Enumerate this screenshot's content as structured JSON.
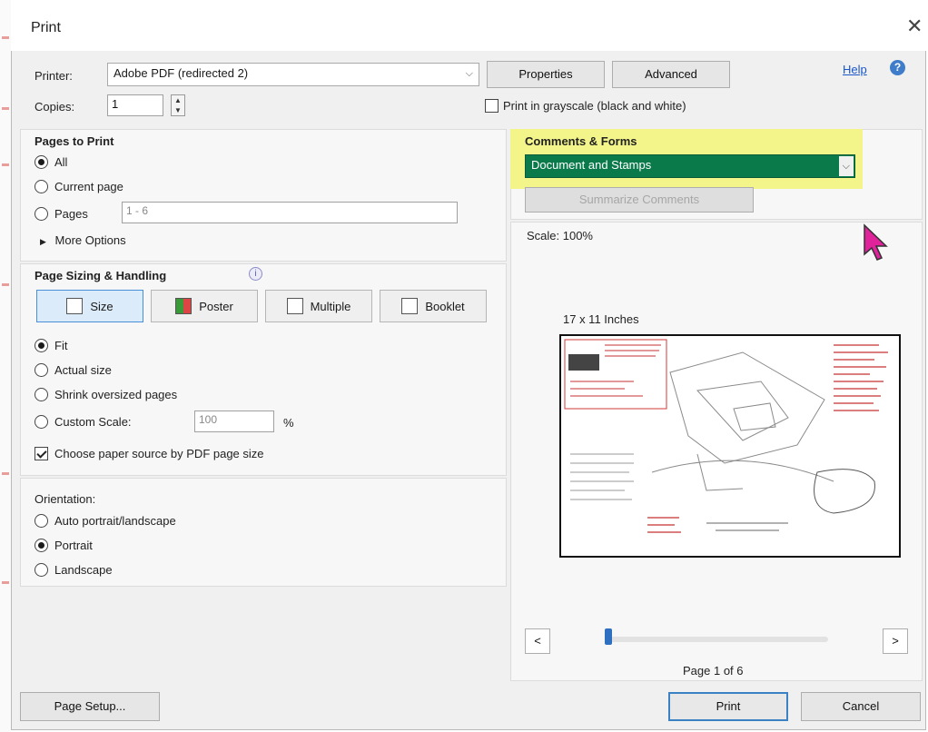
{
  "window": {
    "title": "Print",
    "close_glyph": "✕"
  },
  "printer": {
    "label": "Printer:",
    "value": "Adobe PDF (redirected 2)",
    "properties_button": "Properties",
    "advanced_button": "Advanced",
    "help_link": "Help"
  },
  "copies": {
    "label": "Copies:",
    "value": "1"
  },
  "grayscale": {
    "label": "Print in grayscale (black and white)",
    "checked": false
  },
  "pages_to_print": {
    "heading": "Pages to Print",
    "options": [
      "All",
      "Current page",
      "Pages"
    ],
    "selected": "All",
    "pages_range_placeholder": "1 - 6",
    "more_options": "More Options"
  },
  "page_sizing": {
    "heading": "Page Sizing & Handling",
    "modes": [
      "Size",
      "Poster",
      "Multiple",
      "Booklet"
    ],
    "active_mode": "Size",
    "fit_options": [
      "Fit",
      "Actual size",
      "Shrink oversized pages",
      "Custom Scale:"
    ],
    "selected_fit": "Fit",
    "custom_scale_value": "100",
    "percent_sign": "%",
    "paper_source_label": "Choose paper source by PDF page size",
    "paper_source_checked": true
  },
  "orientation": {
    "heading": "Orientation:",
    "options": [
      "Auto portrait/landscape",
      "Portrait",
      "Landscape"
    ],
    "selected": "Portrait"
  },
  "comments_forms": {
    "heading": "Comments & Forms",
    "value": "Document and Stamps",
    "summarize_button": "Summarize Comments",
    "highlight_color": "#f3f58a",
    "select_color": "#0b7a4b"
  },
  "preview": {
    "scale_label": "Scale: 100%",
    "size_label": "17 x 11 Inches",
    "page_counter": "Page 1 of 6",
    "prev_glyph": "<",
    "next_glyph": ">",
    "page_progress": 0.0
  },
  "footer": {
    "page_setup_button": "Page Setup...",
    "print_button": "Print",
    "cancel_button": "Cancel"
  },
  "colors": {
    "accent": "#3b82c4",
    "cursor": "#e0229b"
  }
}
